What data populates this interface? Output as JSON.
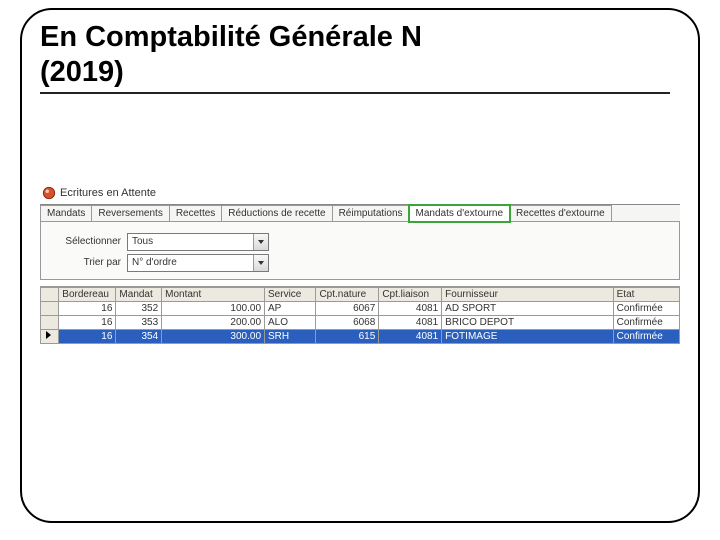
{
  "slide": {
    "title_line1": "En Comptabilité Générale N",
    "title_line2": "(2019)"
  },
  "window": {
    "title": "Ecritures en Attente"
  },
  "tabs": {
    "items": [
      "Mandats",
      "Reversements",
      "Recettes",
      "Réductions de recette",
      "Réimputations",
      "Mandats d'extourne",
      "Recettes d'extourne"
    ],
    "highlighted_index": 5
  },
  "form": {
    "select_label": "Sélectionner",
    "select_value": "Tous",
    "sort_label": "Trier par",
    "sort_value": "N° d'ordre"
  },
  "grid": {
    "columns": [
      "Bordereau",
      "Mandat",
      "Montant",
      "Service",
      "Cpt.nature",
      "Cpt.liaison",
      "Fournisseur",
      "Etat"
    ],
    "rows": [
      {
        "bordereau": "16",
        "mandat": "352",
        "montant": "100.00",
        "service": "AP",
        "cpt_nature": "6067",
        "cpt_liaison": "4081",
        "fournisseur": "AD SPORT",
        "etat": "Confirmée",
        "selected": false
      },
      {
        "bordereau": "16",
        "mandat": "353",
        "montant": "200.00",
        "service": "ALO",
        "cpt_nature": "6068",
        "cpt_liaison": "4081",
        "fournisseur": "BRICO DEPOT",
        "etat": "Confirmée",
        "selected": false
      },
      {
        "bordereau": "16",
        "mandat": "354",
        "montant": "300.00",
        "service": "SRH",
        "cpt_nature": "615",
        "cpt_liaison": "4081",
        "fournisseur": "FOTIMAGE",
        "etat": "Confirmée",
        "selected": true
      }
    ]
  }
}
